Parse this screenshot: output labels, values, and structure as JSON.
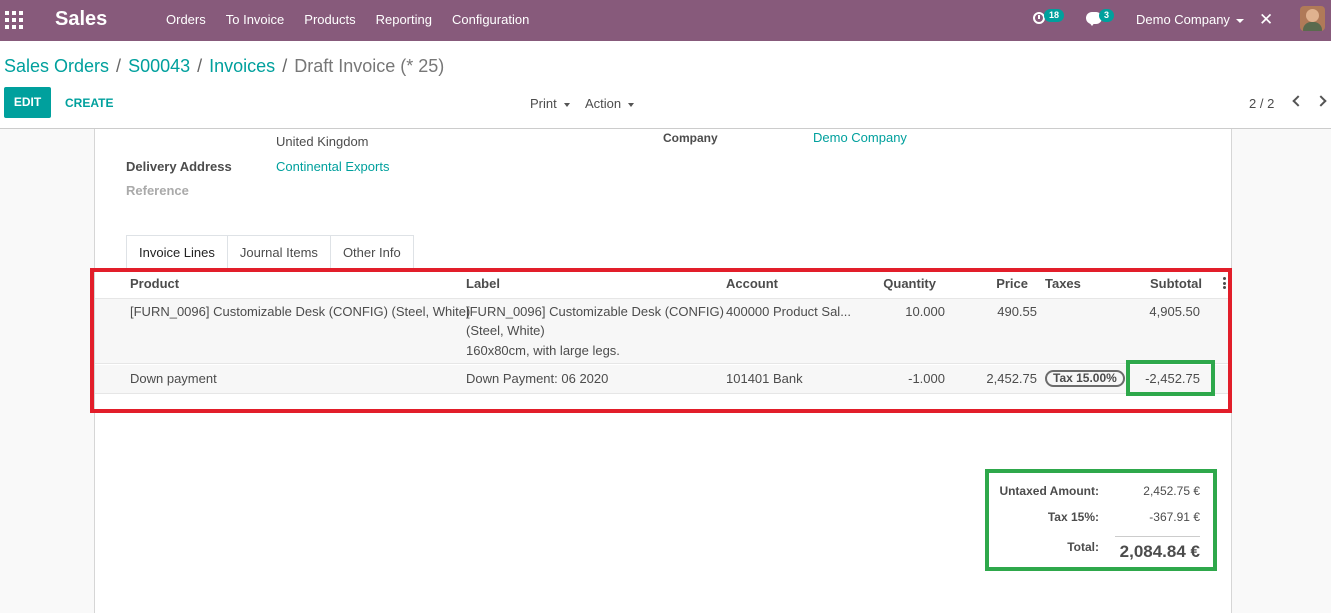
{
  "navbar": {
    "app_name": "Sales",
    "menu": [
      "Orders",
      "To Invoice",
      "Products",
      "Reporting",
      "Configuration"
    ],
    "activity_count": "18",
    "messages_count": "3",
    "company": "Demo Company"
  },
  "breadcrumb": {
    "items": [
      "Sales Orders",
      "S00043",
      "Invoices"
    ],
    "current": "Draft Invoice (* 25)"
  },
  "controls": {
    "edit": "EDIT",
    "create": "CREATE",
    "print": "Print",
    "action": "Action",
    "pager": "2 / 2"
  },
  "form": {
    "country": "United Kingdom",
    "delivery_address_label": "Delivery Address",
    "delivery_address": "Continental Exports",
    "reference_label": "Reference",
    "company_label": "Company",
    "company": "Demo Company"
  },
  "tabs": [
    "Invoice Lines",
    "Journal Items",
    "Other Info"
  ],
  "table": {
    "headers": {
      "product": "Product",
      "label": "Label",
      "account": "Account",
      "quantity": "Quantity",
      "price": "Price",
      "taxes": "Taxes",
      "subtotal": "Subtotal"
    },
    "rows": [
      {
        "product": "[FURN_0096] Customizable Desk (CONFIG) (Steel, White)",
        "label_1": "[FURN_0096] Customizable Desk (CONFIG)",
        "label_2": "(Steel, White)",
        "label_3": "160x80cm, with large legs.",
        "account": "400000 Product Sal...",
        "quantity": "10.000",
        "price": "490.55",
        "taxes": "",
        "subtotal": "4,905.50"
      },
      {
        "product": "Down payment",
        "label_1": "Down Payment: 06 2020",
        "account": "101401 Bank",
        "quantity": "-1.000",
        "price": "2,452.75",
        "taxes": "Tax 15.00%",
        "subtotal": "-2,452.75"
      }
    ]
  },
  "totals": {
    "untaxed_label": "Untaxed Amount:",
    "untaxed": "2,452.75 €",
    "tax_label": "Tax 15%:",
    "tax": "-367.91 €",
    "total_label": "Total:",
    "total": "2,084.84 €"
  },
  "colors": {
    "navbar": "#875a7b",
    "accent": "#00a09d",
    "highlight_red": "#e21e2a",
    "highlight_green": "#2ea84b"
  }
}
